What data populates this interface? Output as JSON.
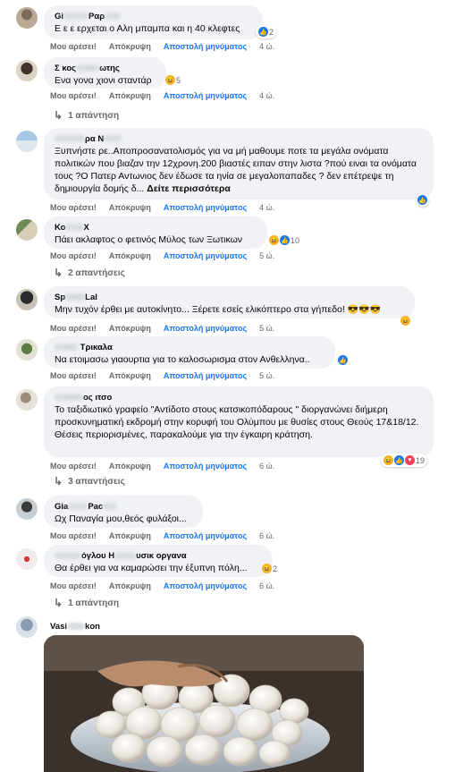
{
  "actions": {
    "like": "Μου αρέσει!",
    "hide": "Απόκρυψη",
    "message": "Αποστολή μηνύματος"
  },
  "comments": [
    {
      "author_prefix": "Gi",
      "author_suffix": "Ραρ",
      "text": "Ε ε ε ερχεται ο Αλη μπαμπα και η 40 κλεφτες",
      "reactions": "2",
      "time": "4 ώ."
    },
    {
      "author_prefix": "Σ   κος",
      "author_suffix": "ωτης",
      "text": "Ενα γονα χιονι σταντάρ",
      "reactions": "5",
      "time": "4 ώ.",
      "replies": "1 απάντηση"
    },
    {
      "author_prefix": "",
      "author_suffix": "ρα Ν",
      "text": "Ξυπνήστε ρε..Αποπροσανατολισμός για να μή μαθουμε ποτε τα μεγάλα ονόματα πολιτικών που βιαζαν την 12χρονη.200 βιαστές ειπαν στην λιστα ?πού ειναι τα ονόματα τους ?Ο Πατερ Αντωνιος δεν έδωσε τα ηνία σε μεγαλοπαπαδες ? δεν επέτρεψε τη δημιουργία δομής δ...",
      "more": "Δείτε περισσότερα",
      "reactions": "",
      "time": "4 ώ."
    },
    {
      "author_prefix": "Κο",
      "author_suffix": "Χ",
      "text": "Πάει ακλαφτος ο φετινός Μύλος των Ξωτικων",
      "reactions": "10",
      "time": "5 ώ.",
      "replies": "2 απαντήσεις"
    },
    {
      "author_prefix": "Sp",
      "author_suffix": "Lal",
      "text": "Μην τυχόν έρθει με αυτοκίνητο... Ξέρετε εσείς ελικόπτερο στα γήπεδο!",
      "reactions": "",
      "time": "5 ώ."
    },
    {
      "author_prefix": "",
      "author_suffix": "Τρικαλα",
      "text": "Να ετοιμασω γιαουρτια για το καλοσωρισμα στον Ανθελληνα..",
      "reactions": "",
      "time": "5 ώ."
    },
    {
      "author_prefix": "",
      "author_suffix": "ος   ιτσο",
      "text": "Το ταξιδιωτικό γραφείο \"Αντίδοτο στους κατσικοπόδαρους \" διοργανώνει διήμερη προσκυνηματική εκδρομή στην κορυφή του Ολύμπου με θυσίες στους Θεούς 17&18/12.\nΘέσεις περιορισμένες, παρακαλούμε για την έγκαιρη κράτηση.",
      "reactions": "19",
      "time": "6 ώ.",
      "replies": "3 απαντήσεις"
    },
    {
      "author_prefix": "Gia",
      "author_suffix": "Pac",
      "text": "Ωχ Παναγία μου,θεός φυλάξοι...",
      "reactions": "",
      "time": "6 ώ."
    },
    {
      "author_prefix": "",
      "author_suffix": "όγλου Η",
      "author_extra": "υσικ   οργανα",
      "text": "Θα έρθει για να καμαρώσει την έξυπνη πόλη...",
      "reactions": "2",
      "time": "6 ώ.",
      "replies": "1 απάντηση"
    },
    {
      "author_prefix": "Vasi",
      "author_suffix": "kon",
      "text": "",
      "reactions": "",
      "time": ""
    }
  ],
  "icons": {
    "like": "like-icon",
    "haha": "haha-icon",
    "love": "love-icon",
    "reply": "reply-arrow-icon"
  },
  "colors": {
    "bubble": "#f0f2f5",
    "meta": "#65676b",
    "link": "#1877f2"
  }
}
